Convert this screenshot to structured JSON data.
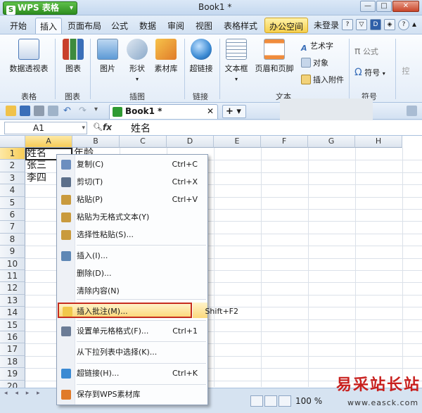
{
  "app": {
    "button_label": "WPS 表格",
    "doc_title": "Book1 *"
  },
  "window_buttons": [
    "—",
    "□",
    "✕"
  ],
  "tabs": [
    "开始",
    "插入",
    "页面布局",
    "公式",
    "数据",
    "审阅",
    "视图",
    "表格样式",
    "办公空间"
  ],
  "active_tab": "插入",
  "right_menu": {
    "login": "未登录"
  },
  "ribbon": {
    "buttons": [
      {
        "label": "数据透视表",
        "color": "#4a78b8"
      },
      {
        "label": "图表",
        "color": "#c8402b"
      },
      {
        "label": "图片",
        "color": "#5d9ad6"
      },
      {
        "label": "形状",
        "color": "#8aa9c9"
      },
      {
        "label": "素材库",
        "color": "#e07b2a"
      },
      {
        "label": "超链接",
        "color": "#3b8ad3"
      },
      {
        "label": "文本框",
        "color": "#7e97b4"
      },
      {
        "label": "页眉和页脚",
        "color": "#9aa8b8"
      }
    ],
    "small": [
      "艺术字",
      "对象",
      "插入附件"
    ],
    "symbol": {
      "formula": "公式",
      "symbol": "符号"
    },
    "groups": [
      "表格",
      "图表",
      "插图",
      "链接",
      "文本",
      "符号"
    ]
  },
  "doc_tab": {
    "name": "Book1 *",
    "close": "✕",
    "new": "+ ▾"
  },
  "formula_bar": {
    "cell_ref": "A1",
    "fx": "fx",
    "value": "姓名"
  },
  "columns": [
    "A",
    "B",
    "C",
    "D",
    "E",
    "F",
    "G",
    "H"
  ],
  "rows": [
    "1",
    "2",
    "3",
    "4",
    "5",
    "6",
    "7",
    "8",
    "9",
    "10",
    "11",
    "12",
    "13",
    "14",
    "15",
    "16",
    "17",
    "18",
    "19",
    "20"
  ],
  "cells": [
    {
      "row": 1,
      "col": "A",
      "value": "姓名"
    },
    {
      "row": 1,
      "col": "B",
      "value": "年龄"
    },
    {
      "row": 2,
      "col": "A",
      "value": "张三"
    },
    {
      "row": 3,
      "col": "A",
      "value": "李四"
    }
  ],
  "context_menu": [
    {
      "label": "复制(C)",
      "shortcut": "Ctrl+C",
      "icon": "copy-icon",
      "color": "#6c8ebf"
    },
    {
      "label": "剪切(T)",
      "shortcut": "Ctrl+X",
      "icon": "scissors-icon",
      "color": "#5c6f8a"
    },
    {
      "label": "粘贴(P)",
      "shortcut": "Ctrl+V",
      "icon": "paste-icon",
      "color": "#c99a3d"
    },
    {
      "label": "粘贴为无格式文本(Y)",
      "shortcut": "",
      "icon": "paste-text-icon",
      "color": "#c99a3d"
    },
    {
      "label": "选择性粘贴(S)...",
      "shortcut": "",
      "icon": "paste-special-icon",
      "color": "#c99a3d"
    },
    {
      "label": "插入(I)...",
      "shortcut": "",
      "icon": "insert-cells-icon",
      "color": "#5e87b5"
    },
    {
      "label": "删除(D)...",
      "shortcut": "",
      "icon": "",
      "color": ""
    },
    {
      "label": "清除内容(N)",
      "shortcut": "",
      "icon": "",
      "color": ""
    },
    {
      "label": "插入批注(M)...",
      "shortcut": "Shift+F2",
      "icon": "comment-icon",
      "color": "#f1c84b"
    },
    {
      "label": "设置单元格格式(F)...",
      "shortcut": "Ctrl+1",
      "icon": "format-cells-icon",
      "color": "#6b7c96"
    },
    {
      "label": "从下拉列表中选择(K)...",
      "shortcut": "",
      "icon": "",
      "color": ""
    },
    {
      "label": "超链接(H)...",
      "shortcut": "Ctrl+K",
      "icon": "globe-link-icon",
      "color": "#3b8ad3"
    },
    {
      "label": "保存到WPS素材库",
      "shortcut": "",
      "icon": "material-library-icon",
      "color": "#e07b2a"
    }
  ],
  "highlighted_item": "插入批注(M)...",
  "status": {
    "zoom": "100 %"
  },
  "watermark": {
    "text": "易采站长站",
    "url": "www.easck.com"
  }
}
